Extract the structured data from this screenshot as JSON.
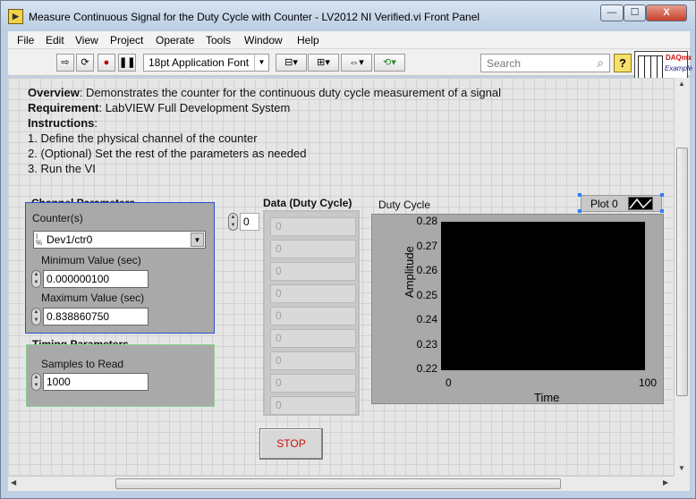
{
  "window": {
    "title": "Measure Continuous Signal for the Duty Cycle with Counter - LV2012 NI Verified.vi Front Panel",
    "icon": "labview-vi-icon",
    "controls": {
      "minimize": "—",
      "maximize": "☐",
      "close": "X"
    }
  },
  "menu": [
    "File",
    "Edit",
    "View",
    "Project",
    "Operate",
    "Tools",
    "Window",
    "Help"
  ],
  "toolbar": {
    "font": "18pt Application Font",
    "search_placeholder": "Search",
    "help": "?",
    "logo_text_1": "DAQmx",
    "logo_text_2": "Example"
  },
  "overview": {
    "overview_label": "Overview",
    "overview_text": ": Demonstrates the counter for the continuous duty cycle measurement of a signal",
    "requirement_label": "Requirement",
    "requirement_text": ": LabVIEW Full Development System",
    "instructions_label": "Instructions",
    "instructions_text": ":",
    "steps": [
      "1. Define the physical channel of the counter",
      "2. (Optional) Set the rest of  the parameters as needed",
      "3. Run the VI"
    ]
  },
  "channel": {
    "title": "Channel Parameters",
    "counter_label": "Counter(s)",
    "counter_value": "Dev1/ctr0",
    "min_label": "Minimum Value (sec)",
    "min_value": "0.000000100",
    "max_label": "Maximum Value (sec)",
    "max_value": "0.838860750"
  },
  "timing": {
    "title": "Timing Parameters",
    "samples_label": "Samples to Read",
    "samples_value": "1000"
  },
  "data_array": {
    "label": "Data (Duty Cycle)",
    "index": "0",
    "values": [
      "0",
      "0",
      "0",
      "0",
      "0",
      "0",
      "0",
      "0",
      "0"
    ]
  },
  "chart": {
    "title": "Duty Cycle",
    "legend": "Plot 0",
    "ylabel": "Amplitude",
    "xlabel": "Time",
    "yticks": [
      "0.28",
      "0.27",
      "0.26",
      "0.25",
      "0.24",
      "0.23",
      "0.22"
    ],
    "xticks": [
      "0",
      "100"
    ]
  },
  "stop_label": "STOP",
  "colors": {
    "stop_text": "#d01010",
    "channel_border": "#2a4fc4",
    "timing_border": "#88d38a",
    "plot_bg": "#000000"
  }
}
